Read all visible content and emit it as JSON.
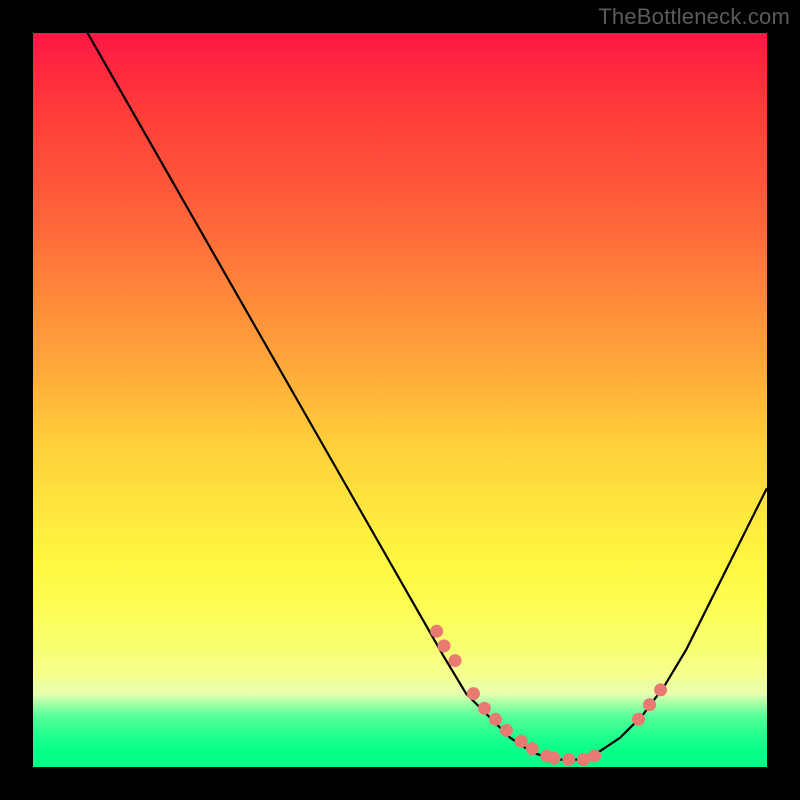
{
  "attribution": "TheBottleneck.com",
  "colors": {
    "page_bg": "#000000",
    "curve": "#000000",
    "dot": "#e87a72",
    "attribution_text": "#5b5b5b"
  },
  "chart_data": {
    "type": "line",
    "title": "",
    "xlabel": "",
    "ylabel": "",
    "xlim": [
      0,
      100
    ],
    "ylim": [
      0,
      100
    ],
    "x": [
      0,
      4,
      8,
      12,
      16,
      20,
      24,
      28,
      32,
      36,
      40,
      44,
      48,
      52,
      56,
      59,
      62,
      65,
      68,
      71,
      74,
      77,
      80,
      83,
      86,
      89,
      92,
      95,
      98,
      100
    ],
    "values": [
      113,
      106,
      99,
      92,
      85,
      78,
      71,
      64,
      57,
      50,
      43,
      36,
      29,
      22,
      15,
      10,
      7,
      4,
      2,
      1,
      1,
      2,
      4,
      7,
      11,
      16,
      22,
      28,
      34,
      38
    ],
    "note": "values are in percent of plot height measured from bottom (0=bottom, 100=top); leftmost value >100 means the curve enters from above the top edge",
    "dots_x": [
      55,
      56,
      57.5,
      60,
      61.5,
      63,
      64.5,
      66.5,
      68,
      70,
      71,
      73,
      75,
      76.5,
      82.5,
      84,
      85.5
    ],
    "dots_values": [
      18.5,
      16.5,
      14.5,
      10,
      8,
      6.5,
      5,
      3.5,
      2.5,
      1.5,
      1.2,
      1,
      1,
      1.5,
      6.5,
      8.5,
      10.5
    ]
  }
}
